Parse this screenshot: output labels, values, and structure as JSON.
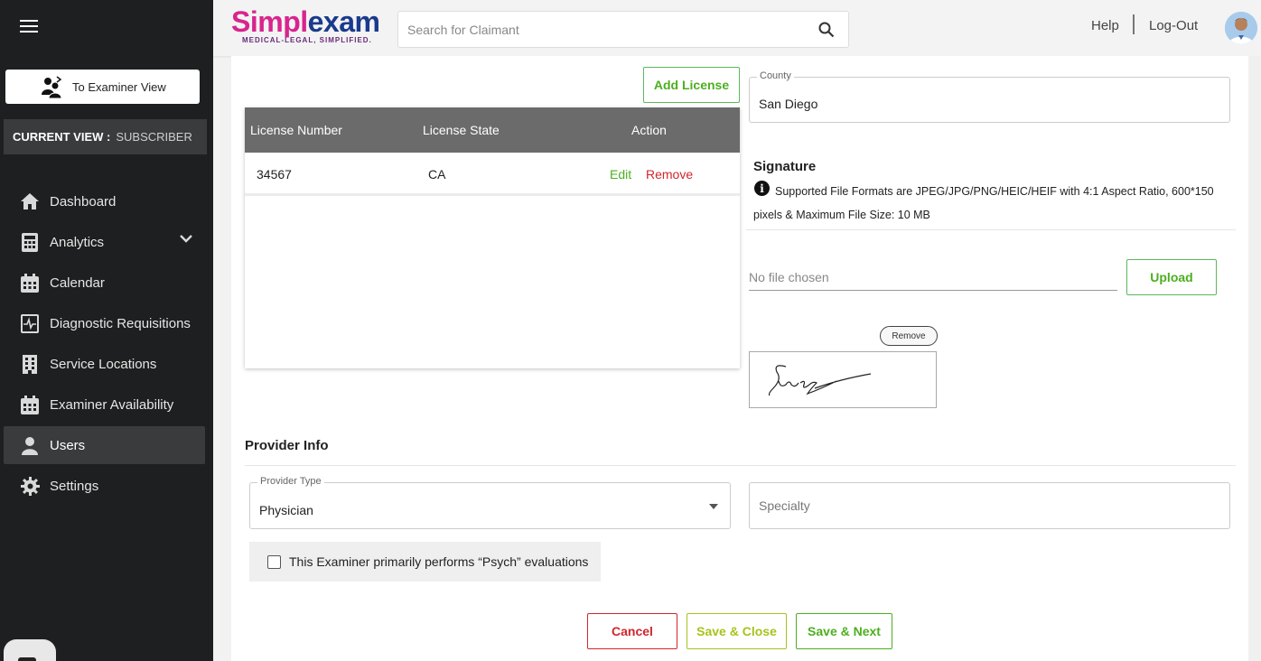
{
  "sidebar": {
    "examiner_view_label": "To Examiner View",
    "current_view_label": "CURRENT VIEW :",
    "current_view_value": "SUBSCRIBER",
    "items": [
      {
        "label": "Dashboard",
        "icon": "home-icon"
      },
      {
        "label": "Analytics",
        "icon": "calculator-icon"
      },
      {
        "label": "Calendar",
        "icon": "calendar-icon"
      },
      {
        "label": "Diagnostic Requisitions",
        "icon": "requisition-icon"
      },
      {
        "label": "Service Locations",
        "icon": "building-icon"
      },
      {
        "label": "Examiner Availability",
        "icon": "calendar-check-icon"
      },
      {
        "label": "Users",
        "icon": "user-icon",
        "active": true
      },
      {
        "label": "Settings",
        "icon": "gear-icon"
      }
    ]
  },
  "header": {
    "logo_part1": "Simpl",
    "logo_part2": "exam",
    "logo_tagline": "MEDICAL-LEGAL, SIMPLIFIED.",
    "search_placeholder": "Search for Claimant",
    "help_label": "Help",
    "logout_label": "Log-Out"
  },
  "license": {
    "add_label": "Add License",
    "columns": [
      "License Number",
      "License State",
      "Action"
    ],
    "rows": [
      {
        "number": "34567",
        "state": "CA",
        "edit": "Edit",
        "remove": "Remove"
      }
    ]
  },
  "county": {
    "label": "County",
    "value": "San Diego"
  },
  "signature": {
    "title": "Signature",
    "info": "Supported File Formats are JPEG/JPG/PNG/HEIC/HEIF with 4:1 Aspect Ratio, 600*150 pixels & Maximum File Size: 10 MB",
    "file_status": "No file chosen",
    "upload_label": "Upload",
    "remove_label": "Remove"
  },
  "provider": {
    "title": "Provider Info",
    "type_label": "Provider Type",
    "type_value": "Physician",
    "specialty_placeholder": "Specialty",
    "psych_label": "This Examiner primarily performs “Psych” evaluations"
  },
  "actions": {
    "cancel": "Cancel",
    "save_close": "Save & Close",
    "save_next": "Save & Next"
  },
  "colors": {
    "sidebar_bg": "#1e1f20",
    "green": "#4caf1f",
    "red": "#d0262e",
    "lime": "#a6c41a",
    "brand_pink": "#d8248e",
    "brand_navy": "#1a3a8c"
  }
}
